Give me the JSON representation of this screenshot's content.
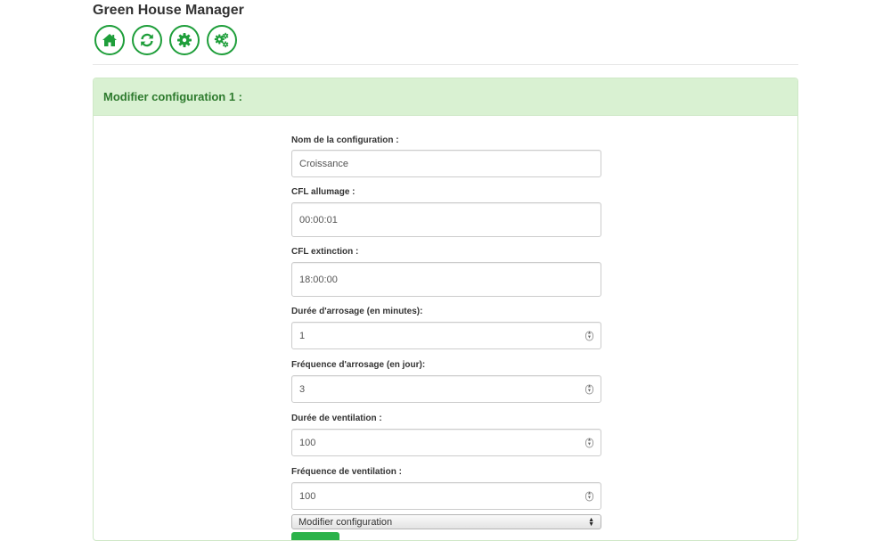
{
  "app": {
    "title": "Green House Manager"
  },
  "toolbar": {
    "buttons": [
      {
        "icon": "home-icon"
      },
      {
        "icon": "refresh-icon"
      },
      {
        "icon": "gear-icon"
      },
      {
        "icon": "gears-icon"
      }
    ],
    "accent": "#1e9e3a"
  },
  "panel": {
    "title": "Modifier configuration 1 :",
    "heading_bg": "#d9f1d2",
    "heading_color": "#2d7a2d"
  },
  "form": {
    "nom": {
      "label": "Nom de la configuration :",
      "value": "Croissance"
    },
    "cfl_allumage": {
      "label": "CFL allumage :",
      "value": "00:00:01"
    },
    "cfl_extinction": {
      "label": "CFL extinction :",
      "value": "18:00:00"
    },
    "duree_arrosage": {
      "label": "Durée d'arrosage (en minutes):",
      "value": "1"
    },
    "frequence_arrosage": {
      "label": "Fréquence d'arrosage (en jour):",
      "value": "3"
    },
    "duree_ventilation": {
      "label": "Durée de ventilation :",
      "value": "100"
    },
    "frequence_ventilation": {
      "label": "Fréquence de ventilation :",
      "value": "100"
    },
    "action_select": {
      "value": "Modifier configuration"
    },
    "submit_color": "#2bb24a"
  }
}
